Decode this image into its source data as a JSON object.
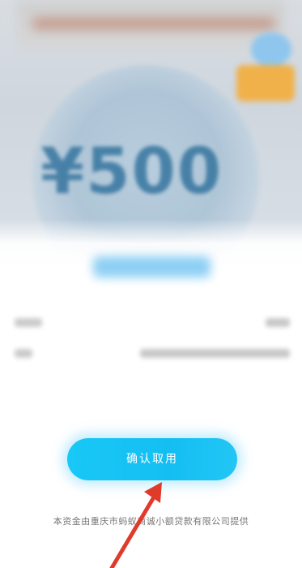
{
  "hero": {
    "amount": "¥500"
  },
  "sheet": {
    "title": "",
    "rows": [
      {
        "label": "",
        "value": ""
      },
      {
        "label": "",
        "value": ""
      }
    ]
  },
  "confirm_button": {
    "label": "确认取用"
  },
  "footer": {
    "provider_text": "本资金由重庆市蚂蚁商诚小额贷款有限公司提供"
  },
  "annotation": {
    "arrow_color": "#e03a2b"
  },
  "colors": {
    "accent": "#16c2f4",
    "amount_text": "#2d6f9b"
  }
}
